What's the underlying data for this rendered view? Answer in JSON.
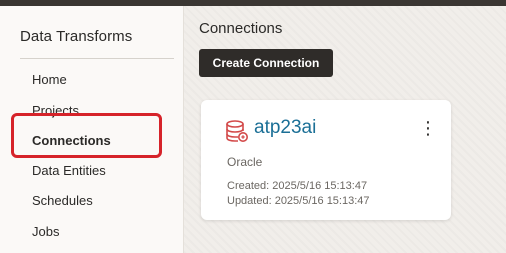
{
  "sidebar": {
    "title": "Data Transforms",
    "items": [
      {
        "label": "Home"
      },
      {
        "label": "Projects"
      },
      {
        "label": "Connections"
      },
      {
        "label": "Data Entities"
      },
      {
        "label": "Schedules"
      },
      {
        "label": "Jobs"
      }
    ],
    "active_item": "Connections"
  },
  "main": {
    "title": "Connections",
    "create_button_label": "Create Connection"
  },
  "connection_card": {
    "name": "atp23ai",
    "type": "Oracle",
    "created": "Created: 2025/5/16 15:13:47",
    "updated": "Updated: 2025/5/16 15:13:47",
    "icon": "database-icon",
    "menu_icon": "kebab-menu-icon"
  },
  "colors": {
    "highlight": "#d6232a",
    "link": "#1b6f96",
    "button_bg": "#2f2c29",
    "db_icon": "#d34a4a"
  }
}
